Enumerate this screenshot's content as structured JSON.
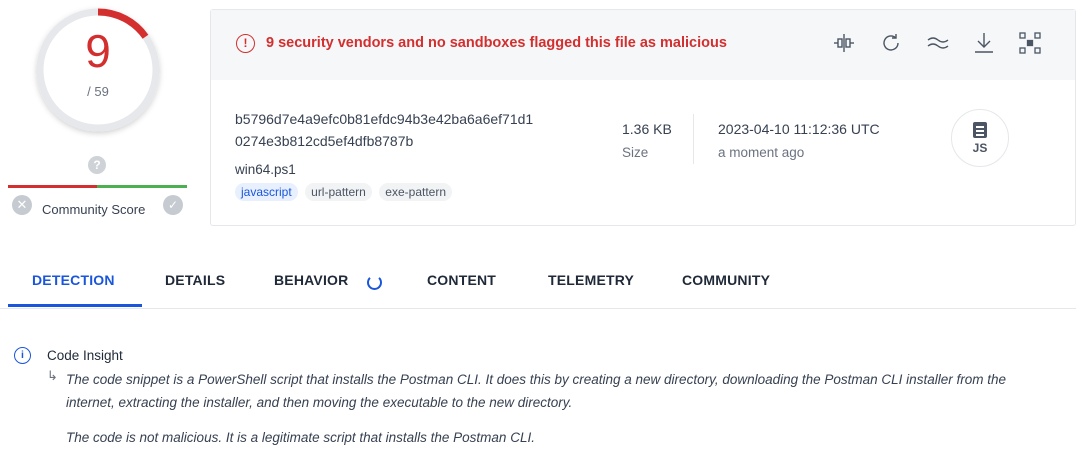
{
  "score": {
    "detections": "9",
    "total": "/ 59",
    "ring_fraction": 0.1525,
    "ring_color": "#d32f2f"
  },
  "community": {
    "label": "Community Score",
    "question": "?",
    "down": "✕",
    "up": "✓"
  },
  "alert": {
    "icon": "!",
    "text": "9 security vendors and no sandboxes flagged this file as malicious",
    "color": "#d32f2f"
  },
  "toolbar": [
    "compare-icon",
    "reanalyze-icon",
    "similar-icon",
    "download-icon",
    "graph-icon"
  ],
  "file": {
    "hash_line1": "b5796d7e4a9efc0b81efdc94b3e42ba6a6ef71d1",
    "hash_line2": "0274e3b812cd5ef4dfb8787b",
    "name": "win64.ps1",
    "tags": [
      "javascript",
      "url-pattern",
      "exe-pattern"
    ],
    "size_value": "1.36 KB",
    "size_label": "Size",
    "date_value": "2023-04-10 11:12:36 UTC",
    "date_label": "a moment ago",
    "type_label": "JS"
  },
  "tabs": [
    "DETECTION",
    "DETAILS",
    "BEHAVIOR",
    "CONTENT",
    "TELEMETRY",
    "COMMUNITY"
  ],
  "active_tab": "DETECTION",
  "accent": "#1a56db",
  "insight": {
    "icon": "i",
    "title": "Code Insight",
    "arrow": "↳",
    "body": "The code snippet is a PowerShell script that installs the Postman CLI. It does this by creating a new directory, downloading the Postman CLI installer from the internet, extracting the installer, and then moving the executable to the new directory.",
    "verdict": "The code is not malicious. It is a legitimate script that installs the Postman CLI."
  }
}
